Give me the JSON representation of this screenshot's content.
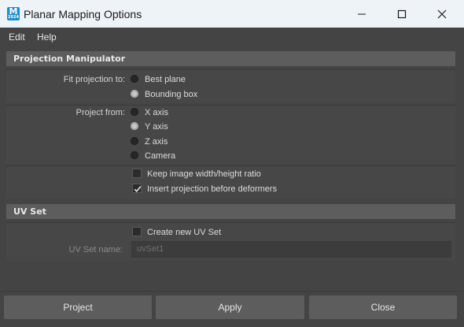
{
  "window": {
    "title": "Planar Mapping Options",
    "app_icon_letter": "M",
    "app_icon_sub": "2024"
  },
  "menu": {
    "items": [
      "Edit",
      "Help"
    ]
  },
  "projection_manipulator": {
    "header": "Projection Manipulator",
    "fit_projection": {
      "label": "Fit projection to:",
      "options": [
        "Best plane",
        "Bounding box"
      ],
      "selected": "Bounding box"
    },
    "project_from": {
      "label": "Project from:",
      "options": [
        "X axis",
        "Y axis",
        "Z axis",
        "Camera"
      ],
      "selected": "Y axis"
    },
    "keep_ratio": {
      "label": "Keep image width/height ratio",
      "checked": false
    },
    "insert_before_deformers": {
      "label": "Insert projection before deformers",
      "checked": true
    }
  },
  "uv_set": {
    "header": "UV Set",
    "create_new": {
      "label": "Create new UV Set",
      "checked": false
    },
    "name": {
      "label": "UV Set name:",
      "placeholder": "uvSet1"
    }
  },
  "buttons": {
    "project": "Project",
    "apply": "Apply",
    "close": "Close"
  }
}
